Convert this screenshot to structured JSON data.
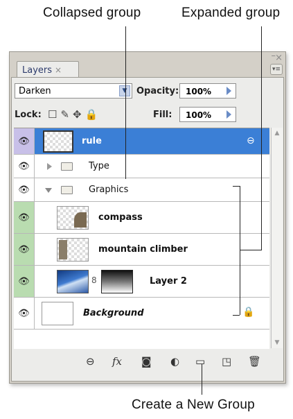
{
  "callouts": {
    "collapsed": "Collapsed group",
    "expanded": "Expanded group",
    "new_group": "Create a New Group"
  },
  "panel": {
    "tab_label": "Layers",
    "tab_close": "×",
    "window_min": "–",
    "window_close": "×",
    "menu_icon": "▾≡",
    "blend_mode": "Darken",
    "opacity_label": "Opacity:",
    "opacity_value": "100%",
    "lock_label": "Lock:",
    "fill_label": "Fill:",
    "fill_value": "100%"
  },
  "layers": [
    {
      "name": "rule",
      "selected": true
    },
    {
      "name": "Type",
      "kind": "group-collapsed"
    },
    {
      "name": "Graphics",
      "kind": "group-expanded"
    },
    {
      "name": "compass"
    },
    {
      "name": "mountain climber"
    },
    {
      "name": "Layer 2"
    },
    {
      "name": "Background",
      "locked": true
    }
  ],
  "toolbar_icons": [
    "link-layers-icon",
    "fx-icon",
    "add-mask-icon",
    "adjustment-layer-icon",
    "new-group-icon",
    "new-layer-icon",
    "delete-layer-icon"
  ],
  "colors": {
    "selection": "#3b7fd6",
    "group_highlight": "#b9dcb0",
    "selected_eye": "#c8c0e8"
  }
}
